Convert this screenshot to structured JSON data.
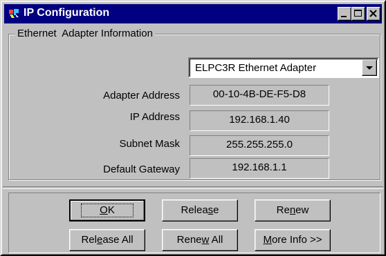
{
  "window": {
    "title": "IP Configuration",
    "icon": "network-config-icon",
    "controls": [
      "minimize-icon",
      "maximize-icon",
      "close-icon"
    ]
  },
  "group": {
    "label": "Ethernet  Adapter Information"
  },
  "adapter_select": {
    "value": "ELPC3R Ethernet Adapter"
  },
  "fields": [
    {
      "label": "Adapter Address",
      "value": "00-10-4B-DE-F5-D8"
    },
    {
      "label": "IP Address",
      "value": "192.168.1.40"
    },
    {
      "label": "Subnet Mask",
      "value": "255.255.255.0"
    },
    {
      "label": "Default Gateway",
      "value": "192.168.1.1"
    }
  ],
  "buttons": {
    "ok": {
      "before": "",
      "key": "O",
      "after": "K"
    },
    "release": {
      "before": "Relea",
      "key": "s",
      "after": "e"
    },
    "renew": {
      "before": "Re",
      "key": "n",
      "after": "ew"
    },
    "release_all": {
      "before": "Rel",
      "key": "e",
      "after": "ase All"
    },
    "renew_all": {
      "before": "Rene",
      "key": "w",
      "after": " All"
    },
    "more_info": {
      "before": "",
      "key": "M",
      "after": "ore Info >>"
    }
  },
  "colors": {
    "title_bar": "#000080",
    "face": "#c0c0c0"
  }
}
